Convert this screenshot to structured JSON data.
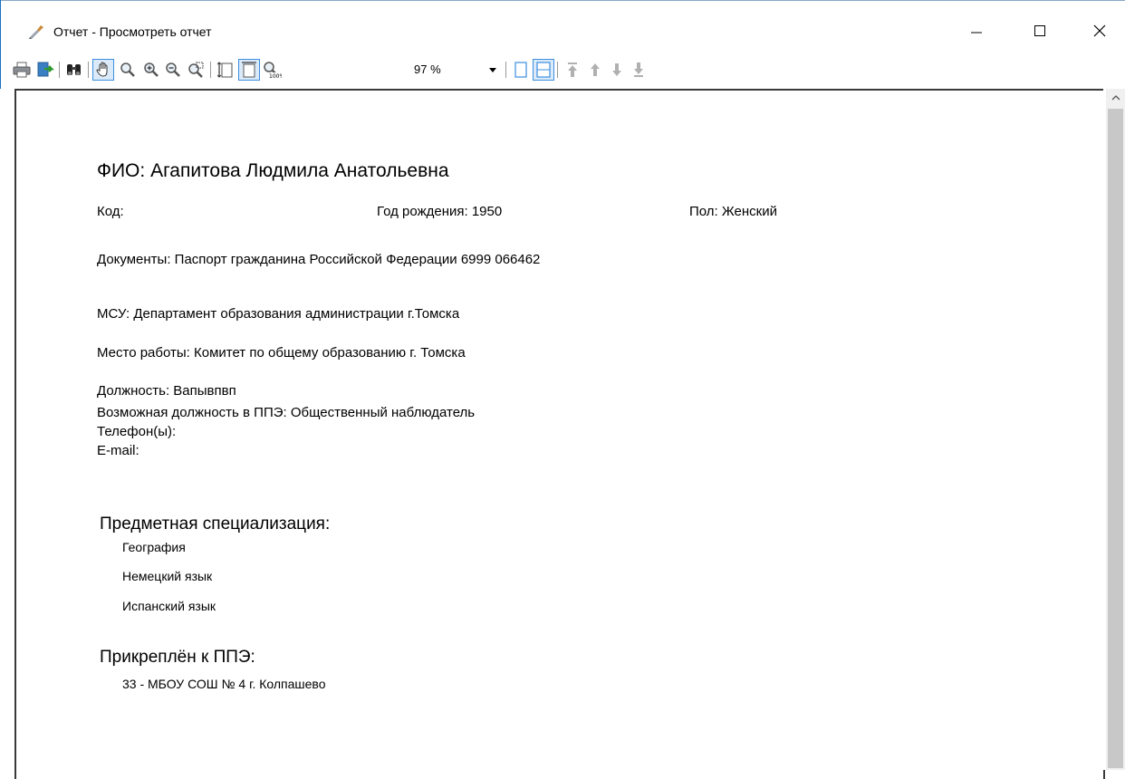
{
  "window": {
    "title": "Отчет - Просмотреть отчет"
  },
  "toolbar": {
    "buttons": [
      {
        "name": "print-icon"
      },
      {
        "name": "export-icon"
      },
      {
        "name": "find-icon"
      },
      {
        "name": "hand-tool-icon"
      },
      {
        "name": "zoom-tool-icon"
      },
      {
        "name": "zoom-in-icon"
      },
      {
        "name": "zoom-out-icon"
      },
      {
        "name": "zoom-area-icon"
      },
      {
        "name": "page-width-icon"
      },
      {
        "name": "whole-page-icon"
      },
      {
        "name": "zoom-100-icon"
      },
      {
        "name": "single-page-icon"
      },
      {
        "name": "two-pages-icon"
      },
      {
        "name": "first-page-icon"
      },
      {
        "name": "previous-page-icon"
      },
      {
        "name": "next-page-icon"
      },
      {
        "name": "last-page-icon"
      }
    ],
    "zoom": "97 %"
  },
  "report": {
    "fio": "ФИО: Агапитова Людмила Анатольевна",
    "code": "Код:",
    "birth_year": "Год рождения: 1950",
    "gender": "Пол: Женский",
    "documents": "Документы: Паспорт гражданина Российской Федерации 6999 066462",
    "msu": "МСУ: Департамент образования администрации г.Томска",
    "workplace": "Место работы: Комитет по общему образованию г. Томска",
    "position": "Должность: Вапывпвп",
    "possible_position": "Возможная должность в ППЭ: Общественный наблюдатель",
    "phones": "Телефон(ы):",
    "email": "E-mail:",
    "specialization_title": "Предметная специализация:",
    "specializations": [
      "География",
      "Немецкий язык",
      "Испанский язык"
    ],
    "ppe_title": "Прикреплён к ППЭ:",
    "ppe": "33 - МБОУ СОШ № 4 г. Колпашево"
  },
  "colors": {
    "accent": "#1a6fc4",
    "pressed_bg": "#dbeaf9",
    "pressed_border": "#3d8ee0"
  }
}
